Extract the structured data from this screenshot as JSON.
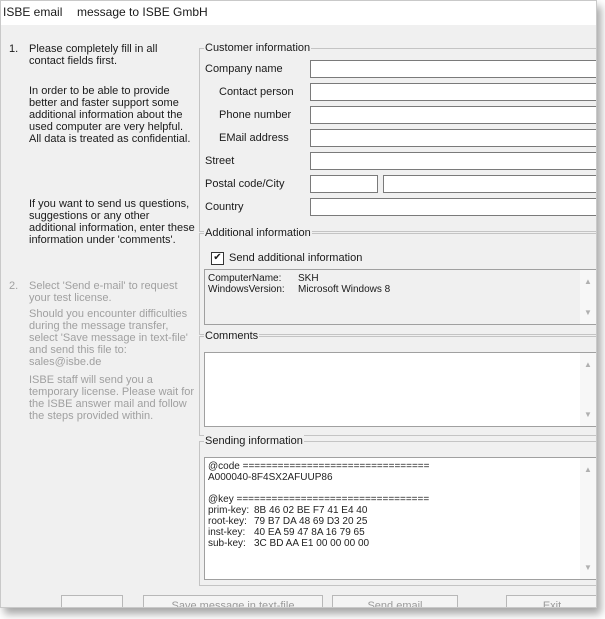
{
  "window": {
    "title": "ISBE email",
    "subtitle": "message to ISBE GmbH"
  },
  "steps": [
    {
      "number": "1.",
      "paragraphs": [
        "Please completely fill in all contact fields first.",
        "In order to be able to provide better and faster support some additional information about the used computer are very helpful. All data is treated as confidential.",
        "If you want to send us questions, suggestions or any other additional information, enter these information under 'comments'."
      ]
    },
    {
      "number": "2.",
      "paragraphs": [
        "Select 'Send e-mail' to request your test license.",
        "Should you encounter difficulties during the message transfer, select 'Save message in text-file' and send this file to: sales@isbe.de",
        "ISBE staff will send you a temporary license. Please wait for the ISBE answer mail and follow the steps provided within."
      ]
    }
  ],
  "customer": {
    "legend": "Customer information",
    "company_label": "Company name",
    "contact_label": "Contact person",
    "phone_label": "Phone number",
    "email_label": "EMail address",
    "street_label": "Street",
    "postal_label": "Postal code/City",
    "country_label": "Country",
    "company_value": "",
    "contact_value": "",
    "phone_value": "",
    "email_value": "",
    "street_value": "",
    "postal_value": "",
    "city_value": "",
    "country_value": ""
  },
  "additional": {
    "legend": "Additional information",
    "checkbox_label": "Send additional information",
    "checked": true,
    "rows": [
      {
        "key": "ComputerName:",
        "value": "SKH"
      },
      {
        "key": "WindowsVersion:",
        "value": "Microsoft Windows 8"
      }
    ]
  },
  "comments": {
    "legend": "Comments",
    "value": ""
  },
  "sending": {
    "legend": "Sending information",
    "code_header": "@code ================================",
    "code_value": "A000040-8F4SX2AFUUP86",
    "key_header": "@key =================================",
    "keys": [
      {
        "key": "prim-key:",
        "value": "8B 46 02 BE F7 41 E4 40"
      },
      {
        "key": "root-key:",
        "value": "79 B7 DA 48 69 D3 20 25"
      },
      {
        "key": "inst-key:",
        "value": "40 EA 59 47 8A 16 79 65"
      },
      {
        "key": "sub-key:",
        "value": "3C BD AA E1 00 00 00 00"
      }
    ]
  },
  "buttons": {
    "save": "Save message in text-file",
    "send": "Send email",
    "exit": "Exit"
  },
  "colors": {
    "window_bg": "#f0f0f0",
    "disabled_text": "#a0a0a0",
    "border": "#c4c4c4"
  }
}
